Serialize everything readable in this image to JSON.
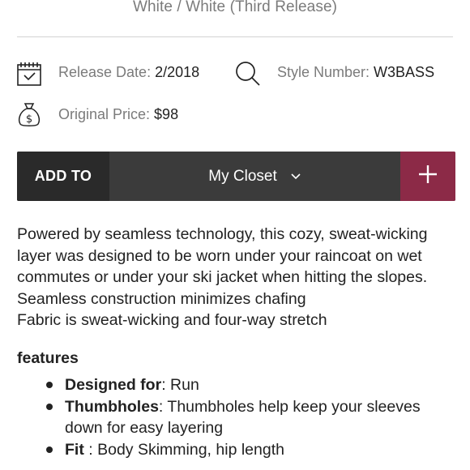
{
  "product": {
    "colorway": "White / White (Third Release)"
  },
  "meta": {
    "release_label": "Release Date:",
    "release_value": "2/2018",
    "style_label": "Style Number:",
    "style_value": "W3BASS",
    "price_label": "Original Price:",
    "price_value": "$98"
  },
  "add_bar": {
    "add_to_label": "ADD TO",
    "closet_label": "My Closet",
    "plus_label": "+"
  },
  "description": {
    "paragraph": "Powered by seamless technology, this cozy, sweat-wicking layer was designed to be worn under your raincoat on wet commutes or under your ski jacket when hitting the slopes.",
    "line2": "Seamless construction minimizes chafing",
    "line3": "Fabric is sweat-wicking and four-way stretch"
  },
  "features": {
    "heading": "features",
    "items": [
      {
        "label": "Designed for",
        "sep": ": ",
        "text": "Run"
      },
      {
        "label": "Thumbholes",
        "sep": ": ",
        "text": "Thumbholes help keep your sleeves down for easy layering"
      },
      {
        "label": "Fit",
        "sep": " : ",
        "text": "Body Skimming, hip length"
      }
    ]
  },
  "colors": {
    "accent": "#8c2a47",
    "bar_dark": "#2a2a2a",
    "bar_mid": "#3b3b3b",
    "muted_text": "#7b7b7b"
  },
  "icons": {
    "calendar": "calendar-icon",
    "search": "search-icon",
    "money_bag": "money-bag-icon",
    "chevron": "chevron-down-icon"
  }
}
